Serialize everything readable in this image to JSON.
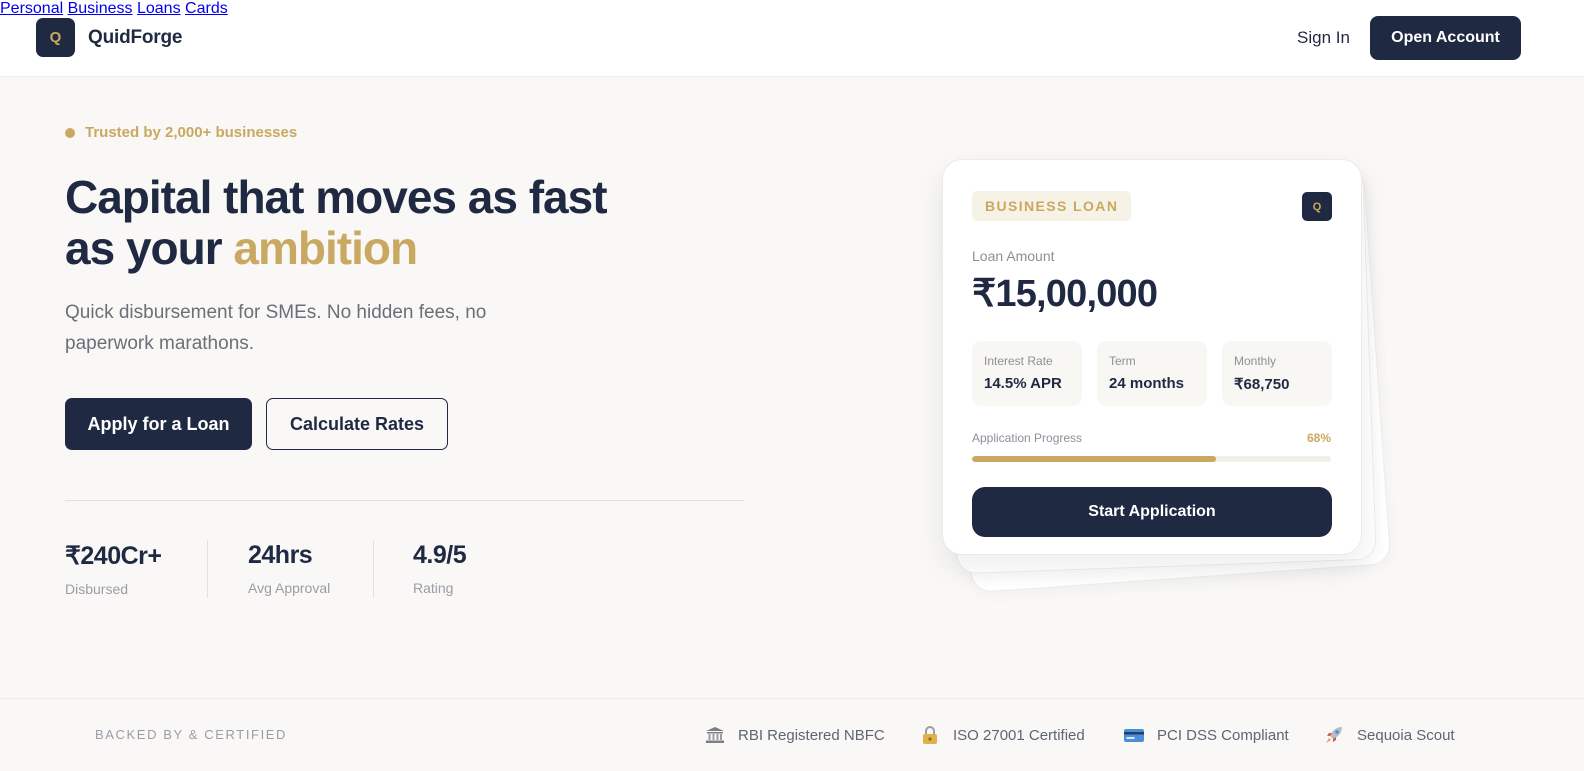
{
  "header": {
    "logo_letter": "Q",
    "brand": "QuidForge",
    "nav": [
      "Personal",
      "Business",
      "Loans",
      "Cards"
    ],
    "sign_in": "Sign In",
    "open_account": "Open Account"
  },
  "hero": {
    "trust_badge": "Trusted by 2,000+ businesses",
    "headline_line1": "Capital that moves as fast",
    "headline_line2_prefix": "as your ",
    "headline_accent": "ambition",
    "subtext": "Quick disbursement for SMEs. No hidden fees, no paperwork marathons.",
    "apply_button": "Apply for a Loan",
    "calculate_button": "Calculate Rates",
    "stats": [
      {
        "value": "₹240Cr+",
        "label": "Disbursed"
      },
      {
        "value": "24hrs",
        "label": "Avg Approval"
      },
      {
        "value": "4.9/5",
        "label": "Rating"
      }
    ]
  },
  "loan_card": {
    "badge": "BUSINESS LOAN",
    "logo_letter": "Q",
    "amount_label": "Loan Amount",
    "amount_value": "₹15,00,000",
    "details": [
      {
        "label": "Interest Rate",
        "value": "14.5% APR"
      },
      {
        "label": "Term",
        "value": "24 months"
      },
      {
        "label": "Monthly",
        "value": "₹68,750"
      }
    ],
    "progress_label": "Application Progress",
    "progress_text": "68%",
    "progress_fraction": 0.68,
    "start_button": "Start Application"
  },
  "footer": {
    "backed_label": "BACKED BY & CERTIFIED",
    "certs": [
      {
        "icon": "bank-icon",
        "label": "RBI Registered NBFC"
      },
      {
        "icon": "lock-icon",
        "label": "ISO 27001 Certified"
      },
      {
        "icon": "credit-card-icon",
        "label": "PCI DSS Compliant"
      },
      {
        "icon": "rocket-icon",
        "label": "Sequoia Scout"
      }
    ]
  },
  "colors": {
    "navy": "#1f2a42",
    "gold": "#c9a962",
    "background": "#f9f8f6"
  }
}
